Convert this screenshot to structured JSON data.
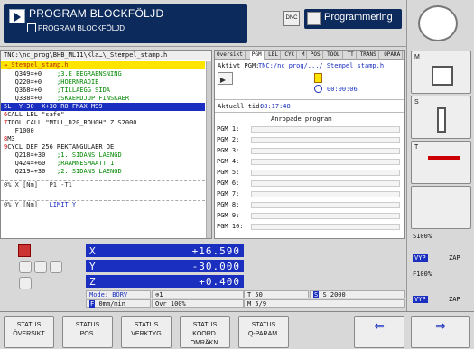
{
  "header": {
    "mode_title": "PROGRAM BLOCKFÖLJD",
    "mode_subtitle": "PROGRAM BLOCKFÖLJD",
    "dnc_label": "DNC",
    "mode_right_label": "Programmering"
  },
  "program": {
    "path": "TNC:\\nc_prog\\BHB_ML11\\Kla…\\_Stempel_stamp.h",
    "header_line": "→_Stempel_stamp.h",
    "lines": [
      {
        "code": "   Q349=+0    ",
        "comment": ";3.E BEGRAENSNING",
        "type": "normal"
      },
      {
        "code": "   Q220=+0    ",
        "comment": ";HOERNRADIE",
        "type": "normal"
      },
      {
        "code": "   Q368=+0    ",
        "comment": ";TILLAEGG SIDA",
        "type": "normal"
      },
      {
        "code": "   Q338=+0    ",
        "comment": ";SKAERDJUP FINSKAER",
        "type": "normal"
      },
      {
        "code": "L  Y-30  X+30 R0 FMAX M99",
        "comment": "",
        "type": "current",
        "num": "5"
      },
      {
        "code": "CALL LBL \"safe\"",
        "comment": "",
        "type": "normal",
        "num": "6"
      },
      {
        "code": "TOOL CALL \"MILL_D20_ROUGH\" Z S2000",
        "comment": "",
        "type": "normal",
        "num": "7"
      },
      {
        "code": "   F1000",
        "comment": "",
        "type": "normal"
      },
      {
        "code": "M3",
        "comment": "",
        "type": "normal",
        "num": "8"
      },
      {
        "code": "CYCL DEF 256 REKTANGULAER OE",
        "comment": "",
        "type": "normal",
        "num": "9"
      },
      {
        "code": "   Q218=+30   ",
        "comment": ";1. SIDANS LAENGD",
        "type": "normal"
      },
      {
        "code": "   Q424=+60   ",
        "comment": ";RAAMNESMAATT 1",
        "type": "normal"
      },
      {
        "code": "   Q219=+30   ",
        "comment": ";2. SIDANS LAENGD",
        "type": "normal"
      }
    ],
    "override_lines": [
      {
        "label": "0% X [Nm]",
        "extra": "P1 -T1"
      },
      {
        "label": "0% Y [Nm]",
        "extra": "LIMIT Y"
      }
    ]
  },
  "status": {
    "tabs": [
      "Översikt",
      "PGM",
      "LBL",
      "CYC",
      "M",
      "POS",
      "TOOL",
      "TT",
      "TRANS",
      "QPARA"
    ],
    "active_tab": "PGM",
    "aktivt_pgm_label": "Aktivt PGM:",
    "aktivt_pgm_value": "TNC:/nc_prog/.../_Stempel_stamp.h",
    "timer_value": "00:00:06",
    "aktuell_tid_label": "Aktuell tid:",
    "aktuell_tid_value": "08:17:48",
    "anropade_label": "Anropade program",
    "pgm_rows": [
      "PGM 1:",
      "PGM 2:",
      "PGM 3:",
      "PGM 4:",
      "PGM 5:",
      "PGM 6:",
      "PGM 7:",
      "PGM 8:",
      "PGM 9:",
      "PGM 10:"
    ]
  },
  "position": {
    "axes": [
      {
        "axis": "X",
        "value": "+16.590"
      },
      {
        "axis": "Y",
        "value": "-30.000"
      },
      {
        "axis": "Z",
        "value": "+0.400"
      }
    ],
    "mode_label": "Mode: BÖRV",
    "feed": "0mm/min",
    "ovr": "Ovr 100%",
    "t_label": "T 50",
    "s_label": "S 2000",
    "m_label": "M 5/9",
    "ref_label": "1"
  },
  "sidebar": {
    "s100": "S100%",
    "vyp1": "VYP",
    "zap1": "ZAP",
    "f100": "F100%",
    "vyp2": "VYP",
    "zap2": "ZAP",
    "m_label": "M",
    "s_label": "S",
    "t_label": "T"
  },
  "softkeys": [
    {
      "line1": "STATUS",
      "line2": "ÖVERSIKT"
    },
    {
      "line1": "STATUS",
      "line2": "POS."
    },
    {
      "line1": "STATUS",
      "line2": "VERKTYG"
    },
    {
      "line1": "STATUS",
      "line2": "KOORD. OMRÄKN."
    },
    {
      "line1": "STATUS",
      "line2": "Q-PARAM."
    }
  ],
  "colors": {
    "mode_bg": "#0c2a5c",
    "axis_bg": "#1a2fbf",
    "cursor_yellow": "#ffe400"
  }
}
